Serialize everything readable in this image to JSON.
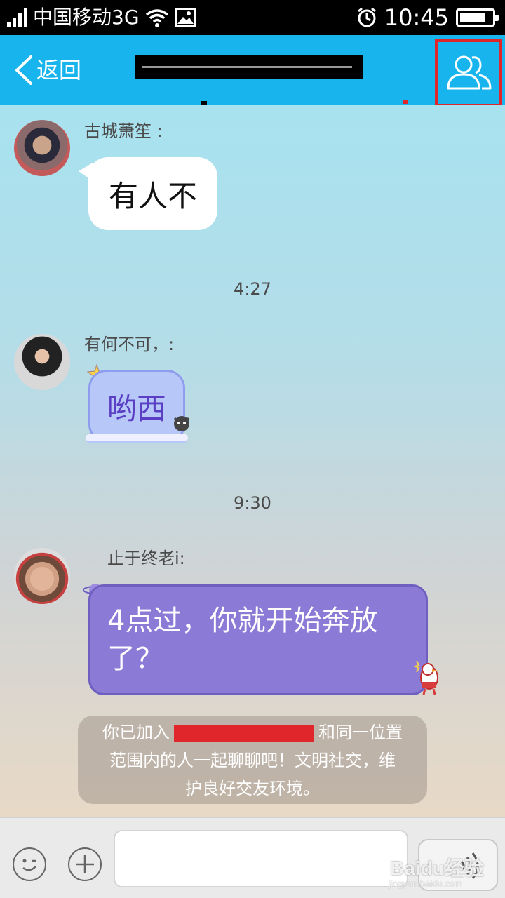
{
  "status_bar": {
    "carrier": "中国移动3G",
    "time": "10:45",
    "battery_level": 0.8,
    "icons": [
      "signal-icon",
      "wifi-icon",
      "image-icon",
      "alarm-icon",
      "battery-icon"
    ]
  },
  "header": {
    "back_label": "返回",
    "group_icon": "group-members-icon"
  },
  "messages": [
    {
      "sender": "古城萧笙 :",
      "text": "有人不"
    },
    {
      "sender": "有何不可，:",
      "text": "哟西"
    },
    {
      "sender": "止于终老i:",
      "line1": "4点过，你就开始奔放",
      "line2": "了？"
    }
  ],
  "timestamps": [
    "4:27",
    "9:30"
  ],
  "system_notice": {
    "before": "你已加入",
    "after": "和同一位置",
    "line2": "范围内的人一起聊聊吧！文明社交，维",
    "line3": "护良好交友环境。"
  },
  "input_bar": {
    "placeholder": "",
    "icons": [
      "emoji-icon",
      "plus-icon",
      "voice-icon"
    ]
  },
  "watermark": {
    "main": "Baidu经验",
    "sub": "jingyan.baidu.com"
  },
  "colors": {
    "header_bg": "#18b4ed",
    "accent_red": "#e0262a",
    "purple_bubble": "#8b7bd6",
    "lavender_bubble": "#b7c7f8"
  }
}
